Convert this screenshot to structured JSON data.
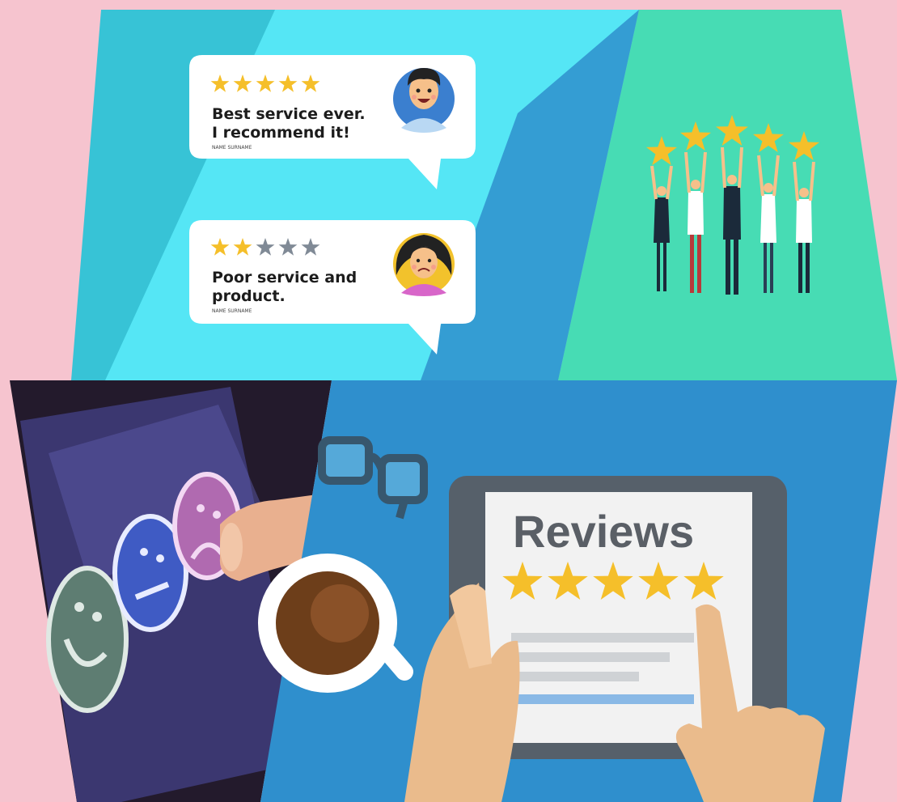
{
  "reviews": [
    {
      "rating": 5,
      "of": 5,
      "line1": "Best service ever.",
      "line2": "I recommend it!",
      "author": "NAME SURNAME"
    },
    {
      "rating": 2,
      "of": 5,
      "line1": "Poor service and",
      "line2": "product.",
      "author": "NAME SURNAME"
    }
  ],
  "tablet": {
    "title": "Reviews",
    "rating": 5,
    "of": 5
  },
  "colors": {
    "background": "#f6c4cf",
    "panel_cyan": "#55e6f5",
    "panel_cyan_dark": "#37c3d6",
    "panel_mint": "#47dcb4",
    "panel_blue": "#2f8fcd",
    "star_gold": "#f5bf2a",
    "star_gray": "#808a96"
  },
  "icons": [
    "star-icon",
    "smiley-happy-icon",
    "smiley-neutral-icon",
    "smiley-sad-icon",
    "eyeglasses-icon",
    "coffee-cup-icon",
    "tablet-icon",
    "hand-icon",
    "person-holding-star-icon"
  ]
}
